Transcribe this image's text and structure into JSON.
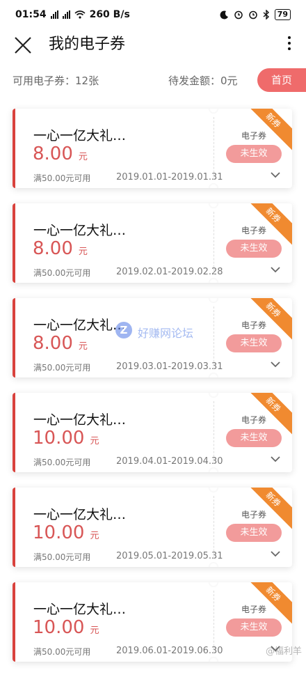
{
  "status_bar": {
    "time": "01:54",
    "net_speed": "260 B/s",
    "battery": "79"
  },
  "header": {
    "title": "我的电子券"
  },
  "summary": {
    "available": "可用电子券：12张",
    "pending": "待发金额：0元",
    "home_button": "首页"
  },
  "coupons": [
    {
      "name": "一心一亿大礼…",
      "amount": "8.00",
      "unit": "元",
      "condition": "满50.00元可用",
      "dates": "2019.01.01-2019.01.31",
      "type": "电子券",
      "status": "未生效",
      "badge": "新券"
    },
    {
      "name": "一心一亿大礼…",
      "amount": "8.00",
      "unit": "元",
      "condition": "满50.00元可用",
      "dates": "2019.02.01-2019.02.28",
      "type": "电子券",
      "status": "未生效",
      "badge": "新券"
    },
    {
      "name": "一心一亿大礼…",
      "amount": "8.00",
      "unit": "元",
      "condition": "满50.00元可用",
      "dates": "2019.03.01-2019.03.31",
      "type": "电子券",
      "status": "未生效",
      "badge": "新券"
    },
    {
      "name": "一心一亿大礼…",
      "amount": "10.00",
      "unit": "元",
      "condition": "满50.00元可用",
      "dates": "2019.04.01-2019.04.30",
      "type": "电子券",
      "status": "未生效",
      "badge": "新券"
    },
    {
      "name": "一心一亿大礼…",
      "amount": "10.00",
      "unit": "元",
      "condition": "满50.00元可用",
      "dates": "2019.05.01-2019.05.31",
      "type": "电子券",
      "status": "未生效",
      "badge": "新券"
    },
    {
      "name": "一心一亿大礼…",
      "amount": "10.00",
      "unit": "元",
      "condition": "满50.00元可用",
      "dates": "2019.06.01-2019.06.30",
      "type": "电子券",
      "status": "未生效",
      "badge": "新券"
    }
  ],
  "watermark": {
    "logo_letter": "Z",
    "site": "好赚网论坛",
    "weibo": "@福利羊"
  },
  "colors": {
    "accent_red": "#d9423d",
    "amount_red": "#d85656",
    "status_pink": "#f29b9b",
    "badge_orange": "#f08a30",
    "home_button": "#ef6b6b"
  },
  "icons": [
    "signal-icon",
    "wifi-icon",
    "moon-icon",
    "alarm-icon",
    "bluetooth-icon",
    "battery-icon",
    "close-icon",
    "more-icon",
    "chevron-down-icon"
  ]
}
